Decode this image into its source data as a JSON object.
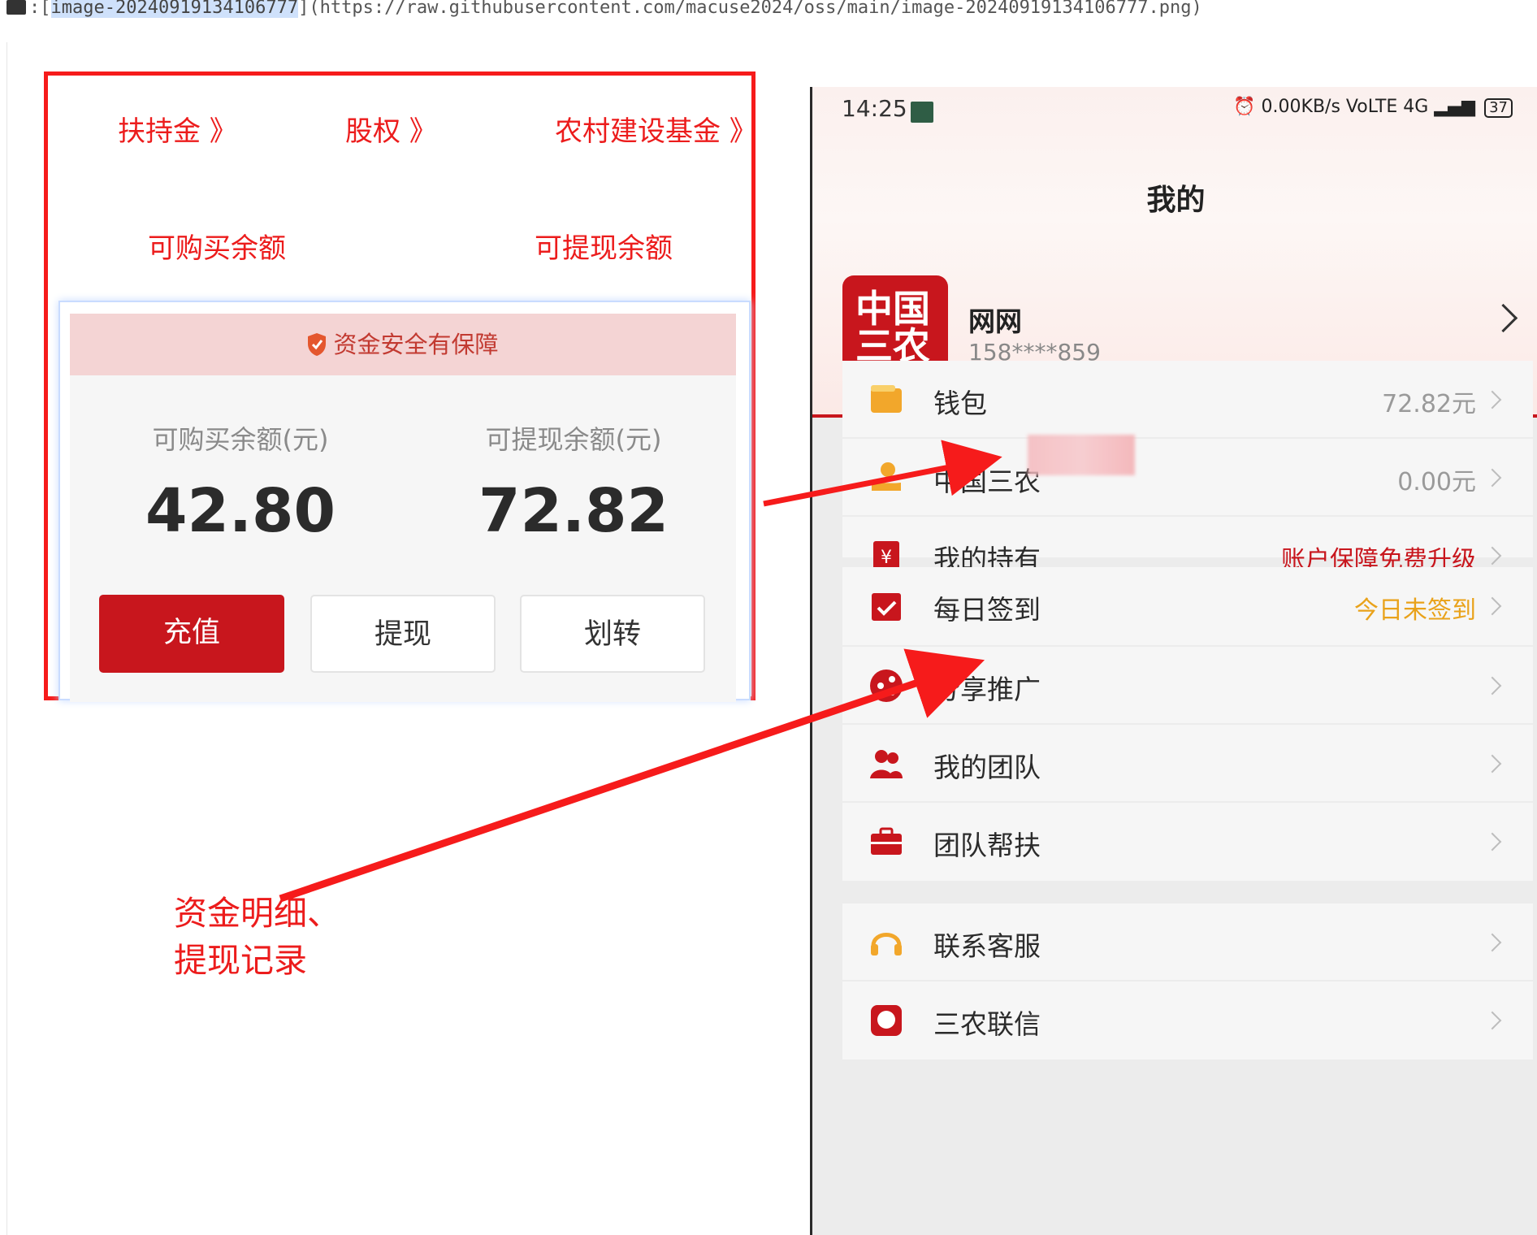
{
  "markdown_line": {
    "prefix": ":[",
    "link_text": "image-20240919134106777",
    "url_text": "](https://raw.githubusercontent.com/macuse2024/oss/main/image-20240919134106777.png)"
  },
  "annotations": {
    "top_links": [
      "扶持金 》",
      "股权 》",
      "农村建设基金 》"
    ],
    "balance_labels": [
      "可购买余额",
      "可提现余额"
    ],
    "note_lines": [
      "资金明细、",
      "提现记录"
    ]
  },
  "card": {
    "banner": "资金安全有保障",
    "balances": [
      {
        "label": "可购买余额(元)",
        "value": "42.80"
      },
      {
        "label": "可提现余额(元)",
        "value": "72.82"
      }
    ],
    "buttons": [
      "充值",
      "提现",
      "划转"
    ]
  },
  "phone": {
    "status": {
      "time": "14:25",
      "right": "⏰ 0.00KB/s  VoLTE 4G",
      "battery": "37"
    },
    "title": "我的",
    "user": {
      "logo_lines": [
        "中国",
        "三农"
      ],
      "name": "网网",
      "phone": "158****859"
    },
    "menu_groups": [
      [
        {
          "label": "钱包",
          "value": "72.82元",
          "icon": "wallet-icon"
        },
        {
          "label": "中国三农",
          "value": "0.00元",
          "icon": "coin-hand-icon"
        },
        {
          "label": "我的持有",
          "value": "账户保障免费升级",
          "icon": "yuan-icon"
        }
      ],
      [
        {
          "label": "每日签到",
          "value": "今日未签到",
          "icon": "calendar-check-icon"
        }
      ],
      [
        {
          "label": "分享推广",
          "value": "",
          "icon": "share-icon"
        },
        {
          "label": "我的团队",
          "value": "",
          "icon": "team-icon"
        },
        {
          "label": "团队帮扶",
          "value": "",
          "icon": "briefcase-icon"
        }
      ],
      [
        {
          "label": "联系客服",
          "value": "",
          "icon": "headset-icon"
        },
        {
          "label": "三农联信",
          "value": "",
          "icon": "message-icon"
        }
      ]
    ]
  },
  "colors": {
    "annotation_red": "#ec1c1c",
    "brand_red": "#c8161d",
    "gold": "#e9a21a"
  }
}
